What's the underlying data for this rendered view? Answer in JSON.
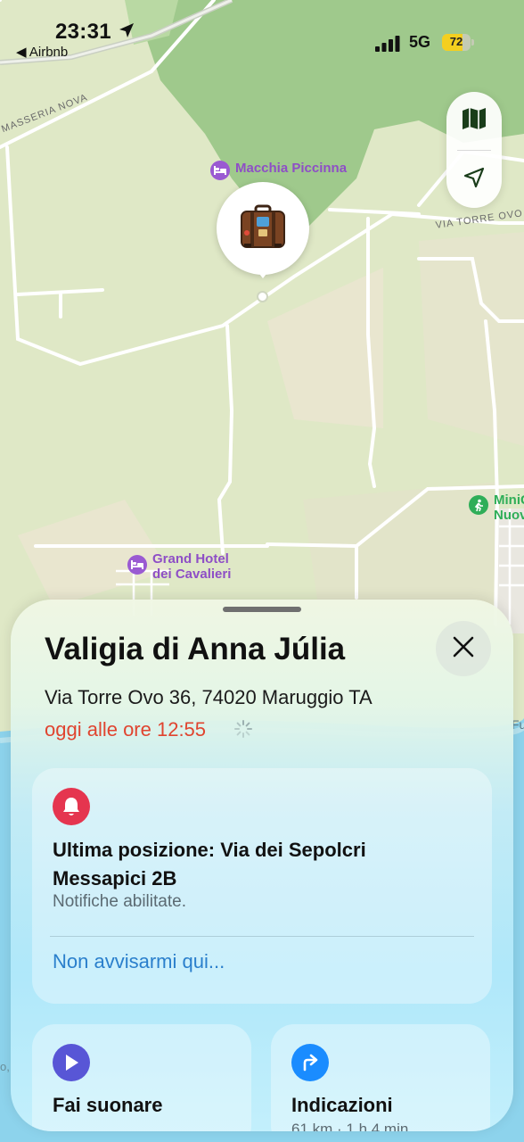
{
  "status_bar": {
    "time": "23:31",
    "back_app": "◀ Airbnb",
    "network": "5G",
    "battery_level": 72,
    "battery_text": "72"
  },
  "map": {
    "road_labels": [
      "MASSERIA NOVA",
      "VIA TORRE OVO"
    ],
    "poi_macchia": "Macchia Piccinna",
    "poi_grand_hotel_line1": "Grand Hotel",
    "poi_grand_hotel_line2": "dei Cavalieri",
    "poi_minigolf_line1": "MiniG",
    "poi_minigolf_line2": "Nuov",
    "edge_fragment": "Fu",
    "edge_fragment_left": "o,",
    "pin_icon": "luggage-icon",
    "controls": [
      "map-mode-icon",
      "location-arrow-icon"
    ]
  },
  "sheet": {
    "title": "Valigia di Anna Júlia",
    "address": "Via Torre Ovo 36, 74020 Maruggio TA",
    "updated": "oggi alle ore 12:55",
    "notification": {
      "title": "Ultima posizione: Via dei Sepolcri Messapici 2B",
      "subtitle": "Notifiche abilitate.",
      "link": "Non avvisarmi qui..."
    },
    "actions": [
      {
        "title": "Fai suonare",
        "subtitle": "",
        "icon": "play-icon",
        "color": "#5856d6"
      },
      {
        "title": "Indicazioni",
        "subtitle": "61 km · 1 h 4 min",
        "icon": "directions-icon",
        "color": "#1a8cff"
      }
    ]
  },
  "colors": {
    "accent_red": "#e0442f",
    "link_blue": "#2a7fcc",
    "bell_red": "#e5354f",
    "poi_purple": "#8e4ec6",
    "poi_green": "#2fae58",
    "map_forest": "#9dc789",
    "map_land": "#dfe9c8",
    "water": "#8dd3ec"
  }
}
